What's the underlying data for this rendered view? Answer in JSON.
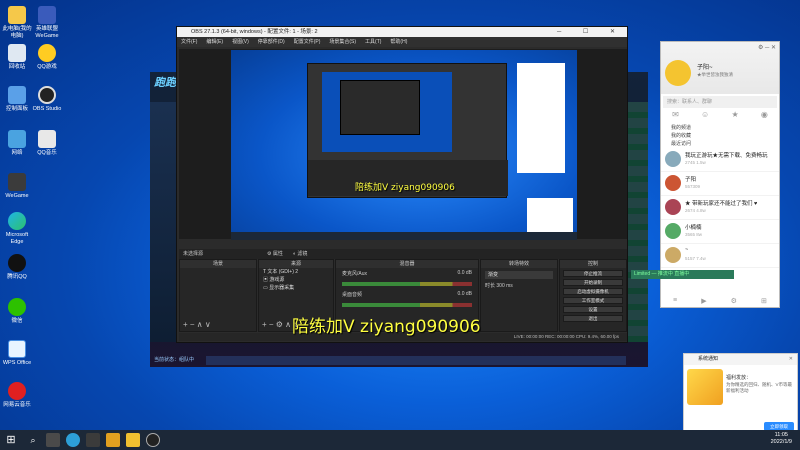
{
  "desktop": {
    "icons": [
      {
        "label": "此电脑(我的电脑)"
      },
      {
        "label": "英雄联盟 WeGame"
      },
      {
        "label": "回收站"
      },
      {
        "label": "QQ游戏"
      },
      {
        "label": "控制面板"
      },
      {
        "label": "OBS Studio"
      },
      {
        "label": "网络"
      },
      {
        "label": "QQ音乐"
      },
      {
        "label": "WeGame"
      },
      {
        "label": "Microsoft Edge"
      },
      {
        "label": "腾讯QQ"
      },
      {
        "label": "微信"
      },
      {
        "label": "WPS Office"
      },
      {
        "label": "网易云音乐"
      }
    ]
  },
  "obs": {
    "title": "OBS 27.1.3 (64-bit, windows) - 配置文件: 1 - 场景: 2",
    "menu": [
      "文件(F)",
      "编辑(E)",
      "视图(V)",
      "停靠部件(D)",
      "配置文件(P)",
      "场景集合(S)",
      "工具(T)",
      "帮助(H)"
    ],
    "scene_label": "未选择源",
    "props_btn": "属性",
    "filters_btn": "滤镜",
    "panel_scenes": "场景",
    "panel_sources": "来源",
    "panel_mixer": "混音器",
    "panel_transitions": "转场特效",
    "panel_controls": "控制",
    "sources": [
      "文本 (GDI+) 2",
      "游戏源",
      "显示器采集"
    ],
    "mixer": [
      {
        "name": "麦克风/Aux",
        "db": "0.0 dB"
      },
      {
        "name": "桌面音频",
        "db": "0.0 dB"
      }
    ],
    "transition": {
      "type": "渐变",
      "duration_label": "时长",
      "duration": "300 ms"
    },
    "controls": [
      "停止推流",
      "开始录制",
      "启动虚拟摄像机",
      "工作室模式",
      "设置",
      "退出"
    ],
    "status": "LIVE: 00:00:00   REC: 00:00:00   CPU: 9.4%, 60.00 fps"
  },
  "watermark": "陪练加V  ziyang090906",
  "game": {
    "logo": "跑跑卡丁车",
    "status_line": "当前状态：组队中"
  },
  "qq": {
    "nickname": "子阳~",
    "status": "★举世皆浊我独清",
    "search_placeholder": "搜索：联系人、群聊",
    "sections": [
      "我的频道",
      "我的收藏",
      "最近访问"
    ],
    "contacts": [
      {
        "name": "我玩正游玩★无需下载、免费畅玩",
        "sub": "2745 1.5w"
      },
      {
        "name": "子阳",
        "sub": "557309"
      },
      {
        "name": "★ 带新玩家还不能过了我们 ♥",
        "sub": "2674 4.8w"
      },
      {
        "name": "小楠楠",
        "sub": "3565 8w"
      },
      {
        "name": "~",
        "sub": "5157 7.4w"
      }
    ]
  },
  "green_tag": "Limited — 推流中 直播中",
  "notice": {
    "title": "系统通知",
    "heading": "福利发放：",
    "body": "为你精选的回归、随机、V币等最新福利活动",
    "button": "立即领取"
  },
  "taskbar": {
    "time": "11:05",
    "date": "2022/1/9"
  }
}
